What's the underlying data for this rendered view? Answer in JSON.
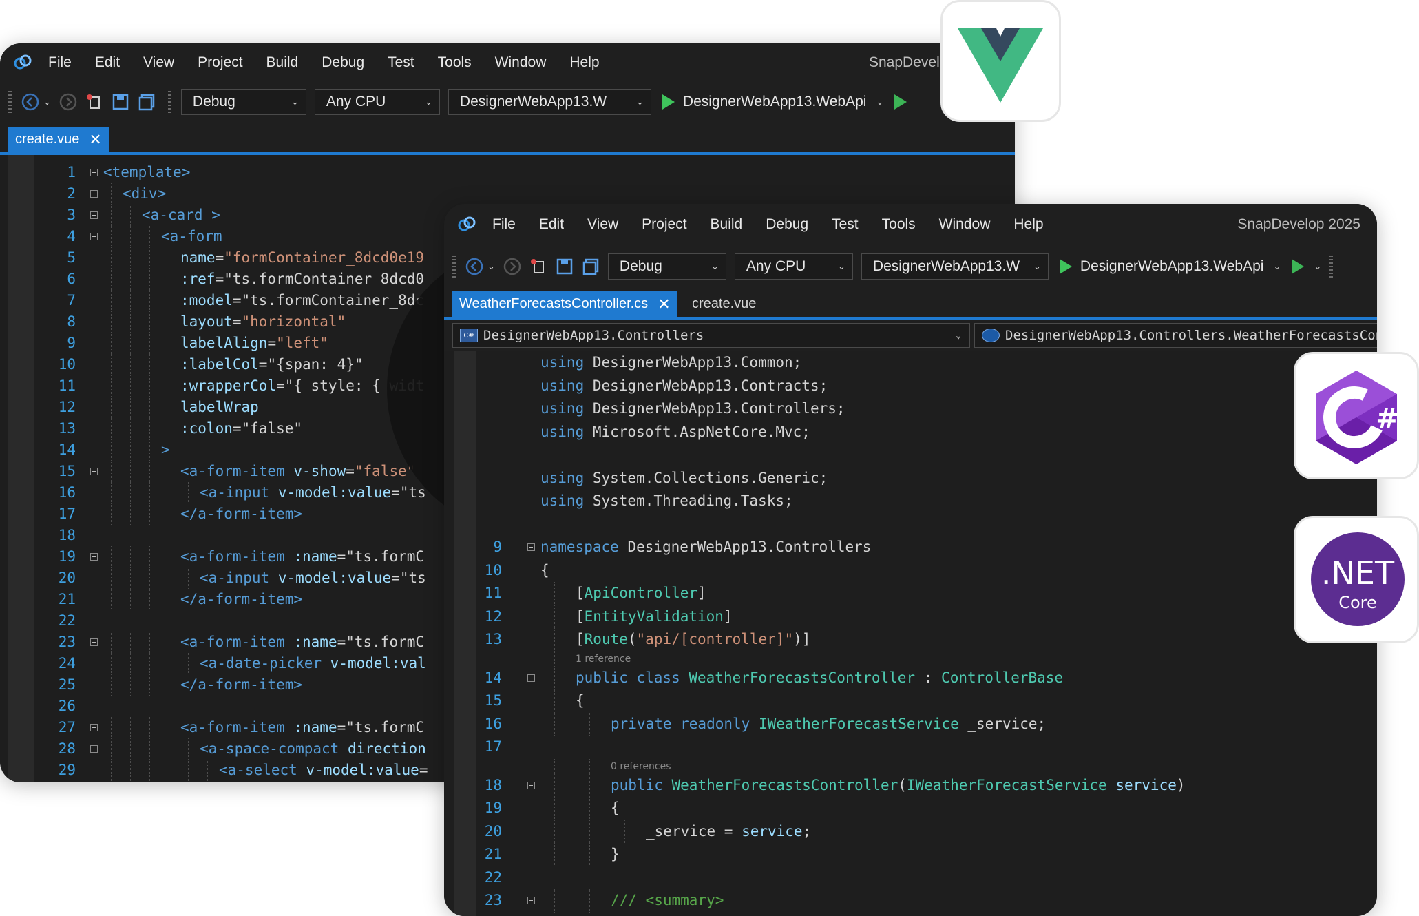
{
  "back_window": {
    "menu": [
      "File",
      "Edit",
      "View",
      "Project",
      "Build",
      "Debug",
      "Test",
      "Tools",
      "Window",
      "Help"
    ],
    "brand": "SnapDevel",
    "toolbar": {
      "config": "Debug",
      "platform": "Any CPU",
      "project": "DesignerWebApp13.W",
      "startup": "DesignerWebApp13.WebApi"
    },
    "tab": {
      "label": "create.vue"
    },
    "lines": [
      {
        "n": "1",
        "indent": 0,
        "fold": true,
        "parts": [
          [
            "tag",
            "<template>"
          ]
        ]
      },
      {
        "n": "2",
        "indent": 1,
        "fold": true,
        "parts": [
          [
            "tag",
            "<div>"
          ]
        ]
      },
      {
        "n": "3",
        "indent": 2,
        "fold": true,
        "parts": [
          [
            "tag",
            "<a-card"
          ],
          [
            "plain",
            " "
          ],
          [
            "tag",
            ">"
          ]
        ]
      },
      {
        "n": "4",
        "indent": 3,
        "fold": true,
        "parts": [
          [
            "tag",
            "<a-form"
          ]
        ]
      },
      {
        "n": "5",
        "indent": 4,
        "fold": false,
        "parts": [
          [
            "attr",
            "name"
          ],
          [
            "plain",
            "="
          ],
          [
            "str",
            "\"formContainer_8dcd0e19"
          ]
        ]
      },
      {
        "n": "6",
        "indent": 4,
        "fold": false,
        "parts": [
          [
            "attr",
            ":ref"
          ],
          [
            "plain",
            "=\"ts.formContainer_8dcd0"
          ]
        ]
      },
      {
        "n": "7",
        "indent": 4,
        "fold": false,
        "parts": [
          [
            "attr",
            ":model"
          ],
          [
            "plain",
            "=\"ts.formContainer_8dc"
          ]
        ]
      },
      {
        "n": "8",
        "indent": 4,
        "fold": false,
        "parts": [
          [
            "attr",
            "layout"
          ],
          [
            "plain",
            "="
          ],
          [
            "str",
            "\"horizontal\""
          ]
        ]
      },
      {
        "n": "9",
        "indent": 4,
        "fold": false,
        "parts": [
          [
            "attr",
            "labelAlign"
          ],
          [
            "plain",
            "="
          ],
          [
            "str",
            "\"left\""
          ]
        ]
      },
      {
        "n": "10",
        "indent": 4,
        "fold": false,
        "parts": [
          [
            "attr",
            ":labelCol"
          ],
          [
            "plain",
            "=\"{span: 4}\""
          ]
        ]
      },
      {
        "n": "11",
        "indent": 4,
        "fold": false,
        "parts": [
          [
            "attr",
            ":wrapperCol"
          ],
          [
            "plain",
            "=\"{ style: { widt"
          ]
        ]
      },
      {
        "n": "12",
        "indent": 4,
        "fold": false,
        "parts": [
          [
            "attr",
            "labelWrap"
          ]
        ]
      },
      {
        "n": "13",
        "indent": 4,
        "fold": false,
        "parts": [
          [
            "attr",
            ":colon"
          ],
          [
            "plain",
            "=\"false\""
          ]
        ]
      },
      {
        "n": "14",
        "indent": 3,
        "fold": false,
        "parts": [
          [
            "tag",
            ">"
          ]
        ]
      },
      {
        "n": "15",
        "indent": 4,
        "fold": true,
        "parts": [
          [
            "tag",
            "<a-form-item"
          ],
          [
            "plain",
            " "
          ],
          [
            "attr",
            "v-show"
          ],
          [
            "plain",
            "="
          ],
          [
            "str",
            "\"false\""
          ]
        ]
      },
      {
        "n": "16",
        "indent": 5,
        "fold": false,
        "parts": [
          [
            "tag",
            "<a-input"
          ],
          [
            "plain",
            " "
          ],
          [
            "attr",
            "v-model:value"
          ],
          [
            "plain",
            "=\"ts"
          ]
        ]
      },
      {
        "n": "17",
        "indent": 4,
        "fold": false,
        "parts": [
          [
            "tag",
            "</a-form-item>"
          ]
        ]
      },
      {
        "n": "18",
        "indent": 0,
        "fold": false,
        "parts": []
      },
      {
        "n": "19",
        "indent": 4,
        "fold": true,
        "parts": [
          [
            "tag",
            "<a-form-item"
          ],
          [
            "plain",
            " "
          ],
          [
            "attr",
            ":name"
          ],
          [
            "plain",
            "=\"ts.formC"
          ]
        ]
      },
      {
        "n": "20",
        "indent": 5,
        "fold": false,
        "parts": [
          [
            "tag",
            "<a-input"
          ],
          [
            "plain",
            " "
          ],
          [
            "attr",
            "v-model:value"
          ],
          [
            "plain",
            "=\"ts"
          ]
        ]
      },
      {
        "n": "21",
        "indent": 4,
        "fold": false,
        "parts": [
          [
            "tag",
            "</a-form-item>"
          ]
        ]
      },
      {
        "n": "22",
        "indent": 0,
        "fold": false,
        "parts": []
      },
      {
        "n": "23",
        "indent": 4,
        "fold": true,
        "parts": [
          [
            "tag",
            "<a-form-item"
          ],
          [
            "plain",
            " "
          ],
          [
            "attr",
            ":name"
          ],
          [
            "plain",
            "=\"ts.formC"
          ]
        ]
      },
      {
        "n": "24",
        "indent": 5,
        "fold": false,
        "parts": [
          [
            "tag",
            "<a-date-picker"
          ],
          [
            "plain",
            " "
          ],
          [
            "attr",
            "v-model:val"
          ]
        ]
      },
      {
        "n": "25",
        "indent": 4,
        "fold": false,
        "parts": [
          [
            "tag",
            "</a-form-item>"
          ]
        ]
      },
      {
        "n": "26",
        "indent": 0,
        "fold": false,
        "parts": []
      },
      {
        "n": "27",
        "indent": 4,
        "fold": true,
        "parts": [
          [
            "tag",
            "<a-form-item"
          ],
          [
            "plain",
            " "
          ],
          [
            "attr",
            ":name"
          ],
          [
            "plain",
            "=\"ts.formC"
          ]
        ]
      },
      {
        "n": "28",
        "indent": 5,
        "fold": true,
        "parts": [
          [
            "tag",
            "<a-space-compact"
          ],
          [
            "plain",
            " "
          ],
          [
            "attr",
            "direction"
          ]
        ]
      },
      {
        "n": "29",
        "indent": 6,
        "fold": false,
        "parts": [
          [
            "tag",
            "<a-select"
          ],
          [
            "plain",
            " "
          ],
          [
            "attr",
            "v-model:value"
          ],
          [
            "plain",
            "="
          ]
        ]
      }
    ]
  },
  "front_window": {
    "menu": [
      "File",
      "Edit",
      "View",
      "Project",
      "Build",
      "Debug",
      "Test",
      "Tools",
      "Window",
      "Help"
    ],
    "brand": "SnapDevelop 2025",
    "toolbar": {
      "config": "Debug",
      "platform": "Any CPU",
      "project": "DesignerWebApp13.W",
      "startup": "DesignerWebApp13.WebApi"
    },
    "tabs": {
      "active": "WeatherForecastsController.cs",
      "inactive": "create.vue"
    },
    "nav": {
      "left": "DesignerWebApp13.Controllers",
      "right": "DesignerWebApp13.Controllers.WeatherForecastsController",
      "left_icon": "C#"
    },
    "lines": [
      {
        "n": "",
        "indent": 0,
        "fold": false,
        "parts": [
          [
            "kw",
            "using"
          ],
          [
            "plain",
            " DesignerWebApp13.Common;"
          ]
        ]
      },
      {
        "n": "",
        "indent": 0,
        "fold": false,
        "parts": [
          [
            "kw",
            "using"
          ],
          [
            "plain",
            " DesignerWebApp13.Contracts;"
          ]
        ]
      },
      {
        "n": "",
        "indent": 0,
        "fold": false,
        "parts": [
          [
            "kw",
            "using"
          ],
          [
            "plain",
            " DesignerWebApp13.Controllers;"
          ]
        ]
      },
      {
        "n": "",
        "indent": 0,
        "fold": false,
        "parts": [
          [
            "kw",
            "using"
          ],
          [
            "plain",
            " Microsoft.AspNetCore.Mvc;"
          ]
        ]
      },
      {
        "n": "",
        "indent": 0,
        "fold": false,
        "parts": []
      },
      {
        "n": "",
        "indent": 0,
        "fold": false,
        "parts": [
          [
            "kw",
            "using"
          ],
          [
            "plain",
            " System.Collections.Generic;"
          ]
        ]
      },
      {
        "n": "",
        "indent": 0,
        "fold": false,
        "parts": [
          [
            "kw",
            "using"
          ],
          [
            "plain",
            " System.Threading.Tasks;"
          ]
        ]
      },
      {
        "n": "",
        "indent": 0,
        "fold": false,
        "parts": []
      },
      {
        "n": "9",
        "indent": 0,
        "fold": true,
        "parts": [
          [
            "kw",
            "namespace"
          ],
          [
            "plain",
            " DesignerWebApp13.Controllers"
          ]
        ]
      },
      {
        "n": "10",
        "indent": 0,
        "fold": false,
        "parts": [
          [
            "plain",
            "{"
          ]
        ]
      },
      {
        "n": "11",
        "indent": 1,
        "fold": false,
        "parts": [
          [
            "plain",
            "["
          ],
          [
            "type",
            "ApiController"
          ],
          [
            "plain",
            "]"
          ]
        ]
      },
      {
        "n": "12",
        "indent": 1,
        "fold": false,
        "parts": [
          [
            "plain",
            "["
          ],
          [
            "type",
            "EntityValidation"
          ],
          [
            "plain",
            "]"
          ]
        ]
      },
      {
        "n": "13",
        "indent": 1,
        "fold": false,
        "parts": [
          [
            "plain",
            "["
          ],
          [
            "type",
            "Route"
          ],
          [
            "plain",
            "("
          ],
          [
            "str",
            "\"api/[controller]\""
          ],
          [
            "plain",
            ")]"
          ]
        ]
      },
      {
        "n": "",
        "lens": "1 reference",
        "indent": 1
      },
      {
        "n": "14",
        "indent": 1,
        "fold": true,
        "parts": [
          [
            "kw",
            "public class"
          ],
          [
            "plain",
            " "
          ],
          [
            "type",
            "WeatherForecastsController"
          ],
          [
            "plain",
            " : "
          ],
          [
            "type",
            "ControllerBase"
          ]
        ]
      },
      {
        "n": "15",
        "indent": 1,
        "fold": false,
        "parts": [
          [
            "plain",
            "{"
          ]
        ]
      },
      {
        "n": "16",
        "indent": 2,
        "fold": false,
        "parts": [
          [
            "kw",
            "private readonly"
          ],
          [
            "plain",
            " "
          ],
          [
            "type",
            "IWeatherForecastService"
          ],
          [
            "plain",
            " _service;"
          ]
        ]
      },
      {
        "n": "17",
        "indent": 0,
        "fold": false,
        "parts": []
      },
      {
        "n": "",
        "lens": "0 references",
        "indent": 2
      },
      {
        "n": "18",
        "indent": 2,
        "fold": true,
        "parts": [
          [
            "kw",
            "public"
          ],
          [
            "plain",
            " "
          ],
          [
            "type",
            "WeatherForecastsController"
          ],
          [
            "plain",
            "("
          ],
          [
            "type",
            "IWeatherForecastService"
          ],
          [
            "plain",
            " "
          ],
          [
            "attr",
            "service"
          ],
          [
            "plain",
            ")"
          ]
        ]
      },
      {
        "n": "19",
        "indent": 2,
        "fold": false,
        "parts": [
          [
            "plain",
            "{"
          ]
        ]
      },
      {
        "n": "20",
        "indent": 3,
        "fold": false,
        "parts": [
          [
            "plain",
            "_service = "
          ],
          [
            "attr",
            "service"
          ],
          [
            "plain",
            ";"
          ]
        ]
      },
      {
        "n": "21",
        "indent": 2,
        "fold": false,
        "parts": [
          [
            "plain",
            "}"
          ]
        ]
      },
      {
        "n": "22",
        "indent": 0,
        "fold": false,
        "parts": []
      },
      {
        "n": "23",
        "indent": 2,
        "fold": true,
        "parts": [
          [
            "cmt",
            "/// <summary>"
          ]
        ]
      }
    ]
  },
  "badges": {
    "net_main": ".NET",
    "net_sub": "Core",
    "csharp_mark": "#"
  },
  "lock_overlay": {
    "glyph": "</>"
  },
  "colors": {
    "vue_green": "#41b883",
    "vue_dark": "#35495e",
    "csharp_purple": "#6a1fa8",
    "dotnet_purple": "#5c2d91",
    "lock_yellow": "#f9c60a",
    "accent_blue": "#1f7ad0"
  }
}
